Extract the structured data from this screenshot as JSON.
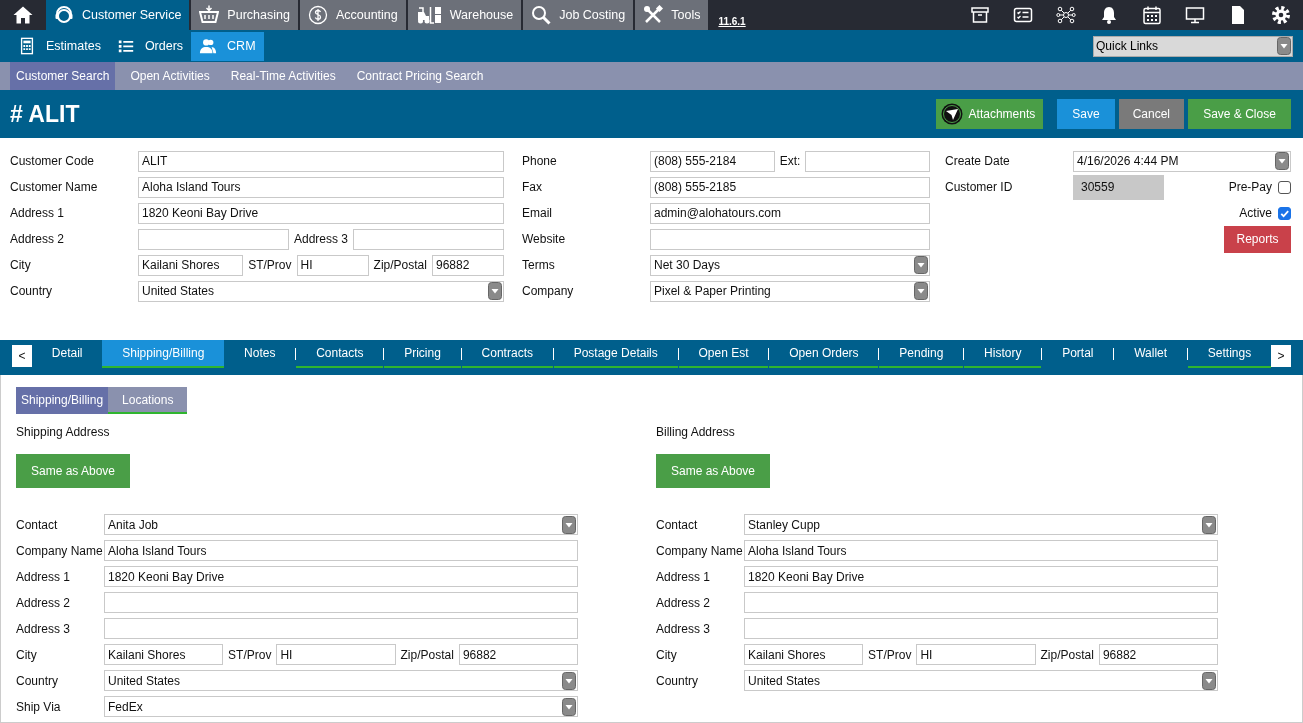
{
  "top_nav": {
    "modules": [
      {
        "label": "Customer Service",
        "selected": true
      },
      {
        "label": "Purchasing",
        "selected": false
      },
      {
        "label": "Accounting",
        "selected": false
      },
      {
        "label": "Warehouse",
        "selected": false
      },
      {
        "label": "Job Costing",
        "selected": false
      },
      {
        "label": "Tools",
        "selected": false
      }
    ],
    "version": "11.6.1"
  },
  "sub_nav": {
    "items": [
      {
        "label": "Estimates",
        "selected": false
      },
      {
        "label": "Orders",
        "selected": false
      },
      {
        "label": "CRM",
        "selected": true
      }
    ],
    "quick_links": "Quick Links"
  },
  "page_tabs": [
    {
      "label": "Customer Search",
      "selected": true
    },
    {
      "label": "Open Activities",
      "selected": false
    },
    {
      "label": "Real-Time Activities",
      "selected": false
    },
    {
      "label": "Contract Pricing Search",
      "selected": false
    }
  ],
  "header": {
    "title": "# ALIT",
    "buttons": [
      {
        "label": "Attachments",
        "kind": "attachments"
      },
      {
        "label": "Save",
        "kind": "primary"
      },
      {
        "label": "Cancel",
        "kind": "neutral"
      },
      {
        "label": "Save & Close",
        "kind": "success"
      }
    ]
  },
  "form": {
    "columns": [
      {
        "rows": [
          {
            "label": "Customer Code",
            "fields": [
              {
                "kind": "text",
                "value": "ALIT"
              }
            ]
          },
          {
            "label": "Customer Name",
            "fields": [
              {
                "kind": "text",
                "value": "Aloha Island Tours"
              }
            ]
          },
          {
            "label": "Address 1",
            "fields": [
              {
                "kind": "text",
                "value": "1820 Keoni Bay Drive"
              }
            ]
          },
          {
            "label": "Address 2",
            "fields": [
              {
                "kind": "text"
              },
              {
                "kind": "label",
                "text": "Address 3"
              },
              {
                "kind": "text"
              }
            ]
          },
          {
            "label": "City",
            "fields": [
              {
                "kind": "text",
                "value": "Kailani Shores"
              },
              {
                "kind": "label",
                "text": "ST/Prov"
              },
              {
                "kind": "text",
                "value": "HI"
              },
              {
                "kind": "label",
                "text": "Zip/Postal"
              },
              {
                "kind": "text",
                "value": "96882"
              }
            ]
          },
          {
            "label": "Country",
            "fields": [
              {
                "kind": "select",
                "value": "United States"
              }
            ]
          }
        ]
      },
      {
        "rows": [
          {
            "label": "Phone",
            "fields": [
              {
                "kind": "text",
                "value": "(808) 555-2184"
              },
              {
                "kind": "label",
                "text": "Ext:"
              },
              {
                "kind": "text"
              }
            ]
          },
          {
            "label": "Fax",
            "fields": [
              {
                "kind": "text",
                "value": "(808) 555-2185"
              }
            ]
          },
          {
            "label": "Email",
            "fields": [
              {
                "kind": "text",
                "value": "admin@alohatours.com"
              }
            ]
          },
          {
            "label": "Website",
            "fields": [
              {
                "kind": "text"
              }
            ]
          },
          {
            "label": "Terms",
            "fields": [
              {
                "kind": "select",
                "value": "Net 30 Days"
              }
            ]
          },
          {
            "label": "Company",
            "fields": [
              {
                "kind": "select",
                "value": "Pixel & Paper Printing"
              }
            ]
          }
        ]
      },
      {
        "rows": [
          {
            "label": "Create Date",
            "fields": [
              {
                "kind": "select",
                "value": "4/16/2026 4:44 PM"
              }
            ]
          },
          {
            "label": "Customer ID",
            "fields": [
              {
                "kind": "readonly",
                "value": "30559"
              },
              {
                "kind": "check",
                "text": "Pre-Pay",
                "checked": false
              }
            ]
          },
          {
            "fields": [
              {
                "kind": "check",
                "text": "Active",
                "checked": true
              }
            ]
          },
          {
            "fields": [
              {
                "kind": "button",
                "text": "Reports"
              }
            ]
          }
        ]
      }
    ]
  },
  "detail_tabs": {
    "scroll_left": "<",
    "scroll_right": ">",
    "tabs": [
      {
        "label": "Detail",
        "selected": false,
        "has_data": false
      },
      {
        "label": "Shipping/Billing",
        "selected": true,
        "has_data": true
      },
      {
        "label": "Notes",
        "selected": false,
        "has_data": false
      },
      {
        "label": "Contacts",
        "selected": false,
        "has_data": true
      },
      {
        "label": "Pricing",
        "selected": false,
        "has_data": true
      },
      {
        "label": "Contracts",
        "selected": false,
        "has_data": true
      },
      {
        "label": "Postage Details",
        "selected": false,
        "has_data": true
      },
      {
        "label": "Open Est",
        "selected": false,
        "has_data": true
      },
      {
        "label": "Open Orders",
        "selected": false,
        "has_data": true
      },
      {
        "label": "Pending",
        "selected": false,
        "has_data": true
      },
      {
        "label": "History",
        "selected": false,
        "has_data": true
      },
      {
        "label": "Portal",
        "selected": false,
        "has_data": false
      },
      {
        "label": "Wallet",
        "selected": false,
        "has_data": false
      },
      {
        "label": "Settings",
        "selected": false,
        "has_data": true
      }
    ]
  },
  "sub_tabs": [
    {
      "label": "Shipping/Billing",
      "selected": true,
      "has_data": false
    },
    {
      "label": "Locations",
      "selected": false,
      "has_data": true
    }
  ],
  "panels": [
    {
      "title": "Shipping Address",
      "button": "Same as Above",
      "rows": [
        {
          "label": "Contact",
          "fields": [
            {
              "kind": "select",
              "value": "Anita Job"
            }
          ]
        },
        {
          "label": "Company Name",
          "fields": [
            {
              "kind": "text",
              "value": "Aloha Island Tours"
            }
          ]
        },
        {
          "label": "Address 1",
          "fields": [
            {
              "kind": "text",
              "value": "1820 Keoni Bay Drive"
            }
          ]
        },
        {
          "label": "Address 2",
          "fields": [
            {
              "kind": "text"
            }
          ]
        },
        {
          "label": "Address 3",
          "fields": [
            {
              "kind": "text"
            }
          ]
        },
        {
          "label": "City",
          "fields": [
            {
              "kind": "text",
              "value": "Kailani Shores"
            },
            {
              "kind": "label",
              "text": "ST/Prov"
            },
            {
              "kind": "text",
              "value": "HI"
            },
            {
              "kind": "label",
              "text": "Zip/Postal"
            },
            {
              "kind": "text",
              "value": "96882"
            }
          ]
        },
        {
          "label": "Country",
          "fields": [
            {
              "kind": "select",
              "value": "United States"
            }
          ]
        },
        {
          "label": "Ship Via",
          "fields": [
            {
              "kind": "select",
              "value": "FedEx"
            }
          ]
        }
      ]
    },
    {
      "title": "Billing Address",
      "button": "Same as Above",
      "rows": [
        {
          "label": "Contact",
          "fields": [
            {
              "kind": "select",
              "value": "Stanley Cupp"
            }
          ]
        },
        {
          "label": "Company Name",
          "fields": [
            {
              "kind": "text",
              "value": "Aloha Island Tours"
            }
          ]
        },
        {
          "label": "Address 1",
          "fields": [
            {
              "kind": "text",
              "value": "1820 Keoni Bay Drive"
            }
          ]
        },
        {
          "label": "Address 2",
          "fields": [
            {
              "kind": "text"
            }
          ]
        },
        {
          "label": "Address 3",
          "fields": [
            {
              "kind": "text"
            }
          ]
        },
        {
          "label": "City",
          "fields": [
            {
              "kind": "text",
              "value": "Kailani Shores"
            },
            {
              "kind": "label",
              "text": "ST/Prov"
            },
            {
              "kind": "text",
              "value": "HI"
            },
            {
              "kind": "label",
              "text": "Zip/Postal"
            },
            {
              "kind": "text",
              "value": "96882"
            }
          ]
        },
        {
          "label": "Country",
          "fields": [
            {
              "kind": "select",
              "value": "United States"
            }
          ]
        }
      ]
    }
  ]
}
